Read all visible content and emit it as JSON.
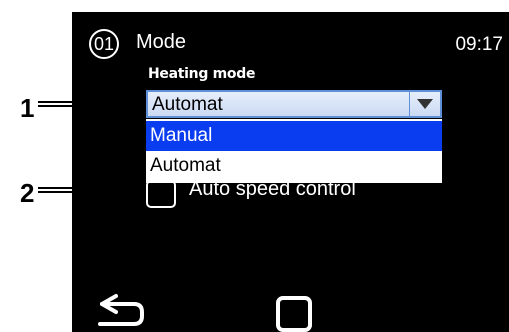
{
  "callouts": [
    {
      "number": "1"
    },
    {
      "number": "2"
    }
  ],
  "header": {
    "step_number": "01",
    "title": "Mode",
    "time": "09:17"
  },
  "heating_mode": {
    "label": "Heating mode",
    "selected_value": "Automat",
    "options": [
      {
        "label": "Manual",
        "highlighted": true
      },
      {
        "label": "Automat",
        "highlighted": false
      }
    ]
  },
  "auto_speed": {
    "label": "Auto speed control",
    "checked": false
  },
  "footer": {
    "back_icon": "back-arrow-icon",
    "home_icon": "home-square-icon"
  }
}
